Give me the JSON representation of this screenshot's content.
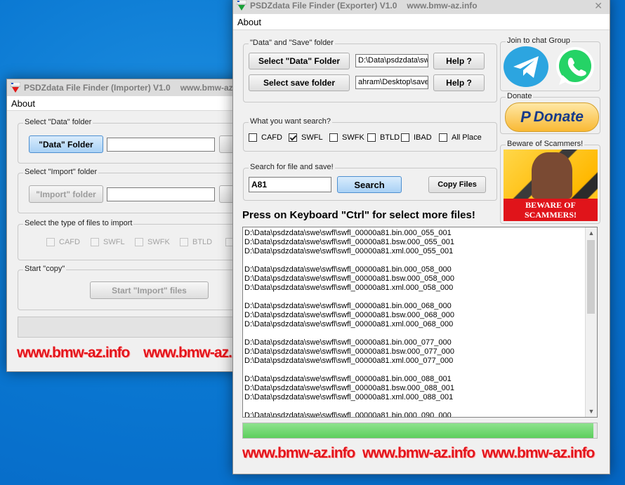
{
  "importer": {
    "title": "PSDZdata File Finder (Importer) V1.0",
    "site": "www.bmw-az.info",
    "menu_about": "About",
    "group_data": "Select \"Data\" folder",
    "data_button": "\"Data\" Folder",
    "group_import": "Select \"Import\" folder",
    "import_button": "\"Import\" folder",
    "group_types": "Select the type of files to import",
    "types": [
      "CAFD",
      "SWFL",
      "SWFK",
      "BTLD"
    ],
    "group_copy": "Start \"copy\"",
    "start_button": "Start \"Import\" files",
    "watermarks": [
      "www.bmw-az.info",
      "www.bmw-az.info"
    ]
  },
  "exporter": {
    "title": "PSDZdata File Finder (Exporter) V1.0",
    "site": "www.bmw-az.info",
    "close_glyph": "✕",
    "menu_about": "About",
    "group_folders": "\"Data\" and \"Save\" folder",
    "data_button": "Select \"Data\" Folder",
    "data_path": "D:\\Data\\psdzdata\\sw",
    "save_button": "Select save folder",
    "save_path": "ahram\\Desktop\\save",
    "help_label": "Help ?",
    "group_search_types": "What you want search?",
    "types": [
      {
        "label": "CAFD",
        "checked": false
      },
      {
        "label": "SWFL",
        "checked": true
      },
      {
        "label": "SWFK",
        "checked": false
      },
      {
        "label": "BTLD",
        "checked": false
      },
      {
        "label": "IBAD",
        "checked": false
      },
      {
        "label": "All Place",
        "checked": false
      }
    ],
    "group_search": "Search for file and save!",
    "search_value": "A81",
    "search_button": "Search",
    "copy_button": "Copy Files",
    "hint": "Press on Keyboard \"Ctrl\" for select more files!",
    "group_chat": "Join to chat Group",
    "group_donate": "Donate",
    "donate_label": "Donate",
    "group_scam": "Beware of Scammers!",
    "scam_banner_1": "BEWARE OF",
    "scam_banner_2": "SCAMMERS!",
    "progress": 0.99,
    "results": [
      "D:\\Data\\psdzdata\\swe\\swfl\\swfl_00000a81.bin.000_055_001",
      "D:\\Data\\psdzdata\\swe\\swfl\\swfl_00000a81.bsw.000_055_001",
      "D:\\Data\\psdzdata\\swe\\swfl\\swfl_00000a81.xml.000_055_001",
      "",
      "D:\\Data\\psdzdata\\swe\\swfl\\swfl_00000a81.bin.000_058_000",
      "D:\\Data\\psdzdata\\swe\\swfl\\swfl_00000a81.bsw.000_058_000",
      "D:\\Data\\psdzdata\\swe\\swfl\\swfl_00000a81.xml.000_058_000",
      "",
      "D:\\Data\\psdzdata\\swe\\swfl\\swfl_00000a81.bin.000_068_000",
      "D:\\Data\\psdzdata\\swe\\swfl\\swfl_00000a81.bsw.000_068_000",
      "D:\\Data\\psdzdata\\swe\\swfl\\swfl_00000a81.xml.000_068_000",
      "",
      "D:\\Data\\psdzdata\\swe\\swfl\\swfl_00000a81.bin.000_077_000",
      "D:\\Data\\psdzdata\\swe\\swfl\\swfl_00000a81.bsw.000_077_000",
      "D:\\Data\\psdzdata\\swe\\swfl\\swfl_00000a81.xml.000_077_000",
      "",
      "D:\\Data\\psdzdata\\swe\\swfl\\swfl_00000a81.bin.000_088_001",
      "D:\\Data\\psdzdata\\swe\\swfl\\swfl_00000a81.bsw.000_088_001",
      "D:\\Data\\psdzdata\\swe\\swfl\\swfl_00000a81.xml.000_088_001",
      "",
      "D:\\Data\\psdzdata\\swe\\swfl\\swfl_00000a81.bin.000_090_000"
    ],
    "watermarks": [
      "www.bmw-az.info",
      "www.bmw-az.info",
      "www.bmw-az.info"
    ]
  }
}
